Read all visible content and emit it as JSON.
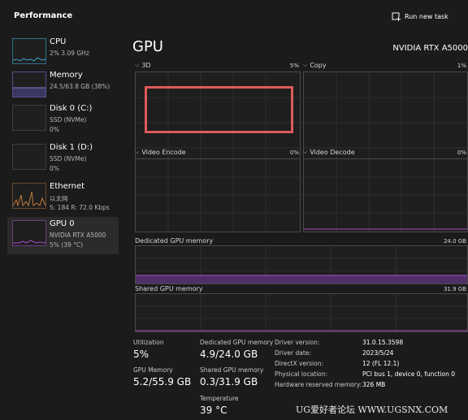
{
  "header": {
    "title": "Performance",
    "run_new_task": "Run new task"
  },
  "sidebar": {
    "items": [
      {
        "name": "CPU",
        "line1": "2% 3.09 GHz",
        "line2": ""
      },
      {
        "name": "Memory",
        "line1": "24.5/63.8 GB (38%)",
        "line2": ""
      },
      {
        "name": "Disk 0 (C:)",
        "line1": "SSD (NVMe)",
        "line2": "0%"
      },
      {
        "name": "Disk 1 (D:)",
        "line1": "SSD (NVMe)",
        "line2": "0%"
      },
      {
        "name": "Ethernet",
        "line1": "以太网",
        "line2": "S: 184  R: 72.0 Kbps"
      },
      {
        "name": "GPU 0",
        "line1": "NVIDIA RTX A5000",
        "line2": "5% (39 °C)"
      }
    ]
  },
  "main": {
    "title": "GPU",
    "model": "NVIDIA RTX A5000",
    "engines": [
      {
        "label": "3D",
        "value": "5%"
      },
      {
        "label": "Copy",
        "value": "1%"
      },
      {
        "label": "Video Encode",
        "value": "0%"
      },
      {
        "label": "Video Decode",
        "value": "0%"
      }
    ],
    "dedicated_mem": {
      "label": "Dedicated GPU memory",
      "value": "24.0 GB"
    },
    "shared_mem": {
      "label": "Shared GPU memory",
      "value": "31.9 GB"
    }
  },
  "stats": {
    "utilization": {
      "label": "Utilization",
      "value": "5%"
    },
    "dedicated": {
      "label": "Dedicated GPU memory",
      "value": "4.9/24.0 GB"
    },
    "gpu_memory": {
      "label": "GPU Memory",
      "value": "5.2/55.9 GB"
    },
    "shared": {
      "label": "Shared GPU memory",
      "value": "0.3/31.9 GB"
    },
    "temperature": {
      "label": "Temperature",
      "value": "39 °C"
    }
  },
  "info": [
    {
      "label": "Driver version:",
      "value": "31.0.15.3598"
    },
    {
      "label": "Driver date:",
      "value": "2023/5/24"
    },
    {
      "label": "DirectX version:",
      "value": "12 (FL 12.1)"
    },
    {
      "label": "Physical location:",
      "value": "PCI bus 1, device 0, function 0"
    },
    {
      "label": "Hardware reserved memory:",
      "value": "326 MB"
    }
  ],
  "watermark": "UG爱好者论坛 WWW.UGSNX.COM",
  "colors": {
    "accent": "#a64fc9",
    "grid": "#2e2e2e",
    "highlight": "#e05a5a"
  },
  "icons": {
    "run_new_task": "run-task-icon",
    "collapse": "chevron-down-icon"
  }
}
